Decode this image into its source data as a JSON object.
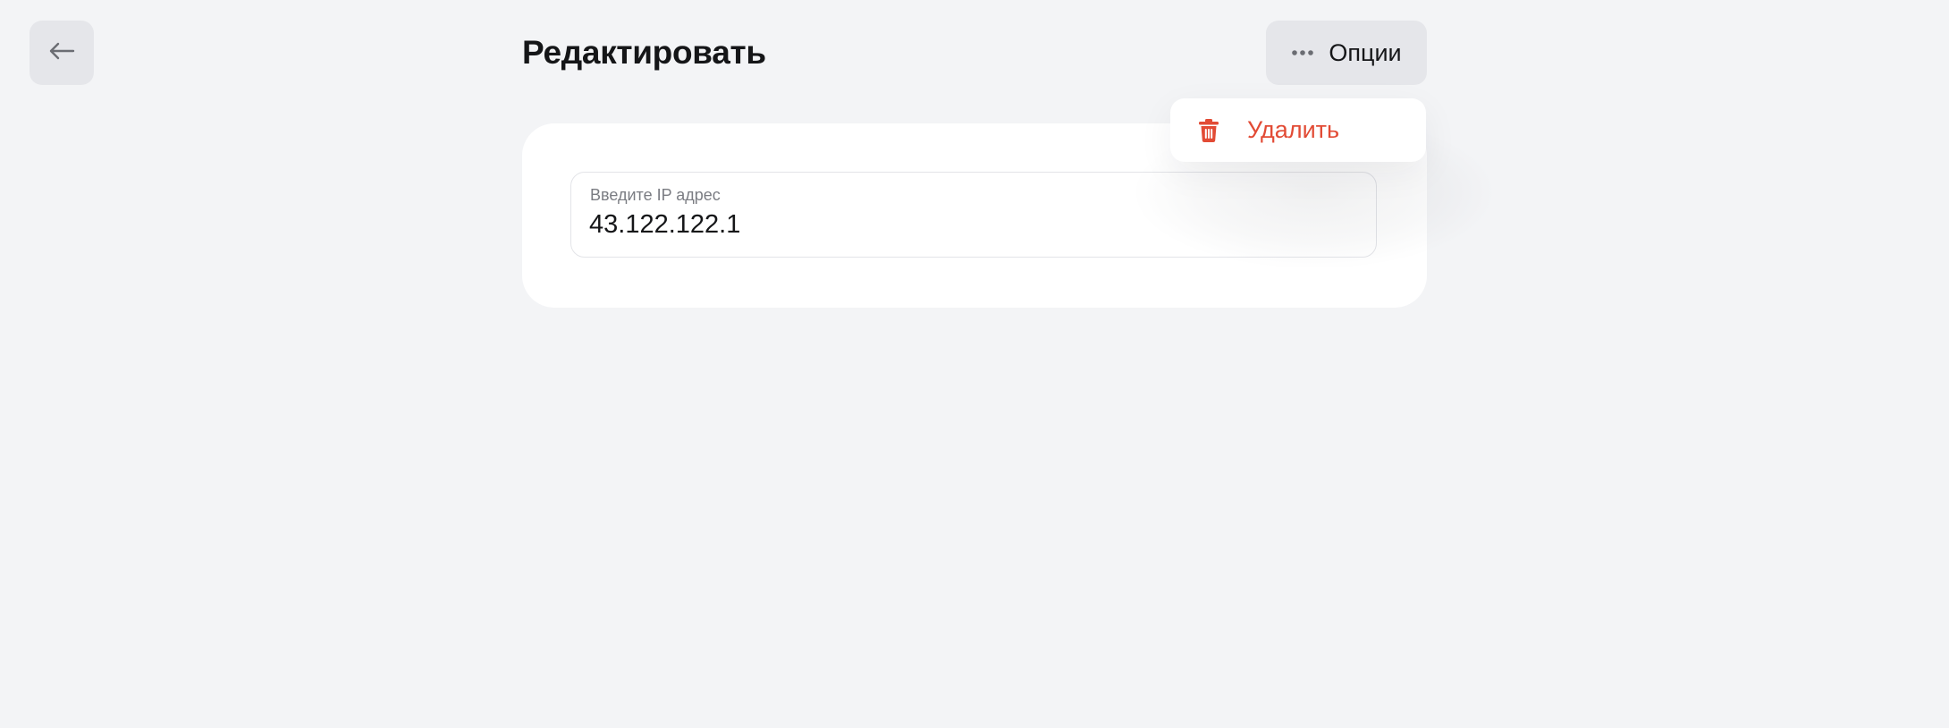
{
  "header": {
    "title": "Редактировать",
    "options_label": "Опции"
  },
  "icons": {
    "back": "arrow-left-icon",
    "options": "ellipsis-icon",
    "delete": "trash-icon"
  },
  "dropdown": {
    "items": [
      {
        "label": "Удалить",
        "color": "#e24b35"
      }
    ]
  },
  "form": {
    "ip_label": "Введите IP адрес",
    "ip_value": "43.122.122.1"
  },
  "colors": {
    "background": "#f3f4f6",
    "button_bg": "#e5e6ea",
    "card_bg": "#ffffff",
    "danger": "#e24b35"
  }
}
